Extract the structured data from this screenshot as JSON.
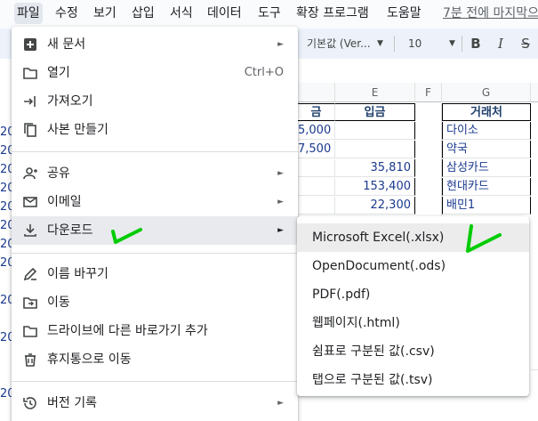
{
  "menubar": {
    "items": [
      "파일",
      "수정",
      "보기",
      "삽입",
      "서식",
      "데이터",
      "도구",
      "확장 프로그램",
      "도움말"
    ],
    "last_edit": "7분 전에 마지막으"
  },
  "toolbar": {
    "font": "기본값 (Ver...",
    "font_size": "10",
    "bold": "B",
    "italic": "I",
    "strike": "S"
  },
  "sheet": {
    "col_headers": [
      "E",
      "F",
      "G"
    ],
    "table_headers": [
      "금",
      "입금",
      "거래처"
    ],
    "left_cells": [
      "20",
      "20",
      "20",
      "20",
      "20",
      "20",
      "20",
      "20",
      "20",
      "20",
      "20"
    ],
    "rows": [
      {
        "d": "5,000",
        "e": "",
        "g": "다이소"
      },
      {
        "d": "7,500",
        "e": "",
        "g": "약국"
      },
      {
        "d": "",
        "e": "35,810",
        "g": "삼성카드"
      },
      {
        "d": "",
        "e": "153,400",
        "g": "현대카드"
      },
      {
        "d": "",
        "e": "22,300",
        "g": "배민1"
      }
    ]
  },
  "file_menu": {
    "items": [
      {
        "label": "새 문서",
        "icon": "plus-box-icon",
        "submenu": true
      },
      {
        "label": "열기",
        "icon": "folder-icon",
        "shortcut": "Ctrl+O"
      },
      {
        "label": "가져오기",
        "icon": "import-icon"
      },
      {
        "label": "사본 만들기",
        "icon": "copy-icon"
      },
      {
        "label": "공유",
        "icon": "person-add-icon",
        "submenu": true
      },
      {
        "label": "이메일",
        "icon": "mail-icon",
        "submenu": true
      },
      {
        "label": "다운로드",
        "icon": "download-icon",
        "submenu": true
      },
      {
        "label": "이름 바꾸기",
        "icon": "rename-icon"
      },
      {
        "label": "이동",
        "icon": "move-folder-icon"
      },
      {
        "label": "드라이브에 다른 바로가기 추가",
        "icon": "drive-shortcut-icon"
      },
      {
        "label": "휴지통으로 이동",
        "icon": "trash-icon"
      },
      {
        "label": "버전 기록",
        "icon": "history-icon",
        "submenu": true
      }
    ],
    "arrow": "►"
  },
  "download_submenu": {
    "items": [
      "Microsoft Excel(.xlsx)",
      "OpenDocument(.ods)",
      "PDF(.pdf)",
      "웹페이지(.html)",
      "쉼표로 구분된 값(.csv)",
      "탭으로 구분된 값(.tsv)"
    ]
  },
  "colors": {
    "highlight": "#e8eaed",
    "annotation": "#00cc00",
    "cell_text": "#1a3a8f"
  }
}
